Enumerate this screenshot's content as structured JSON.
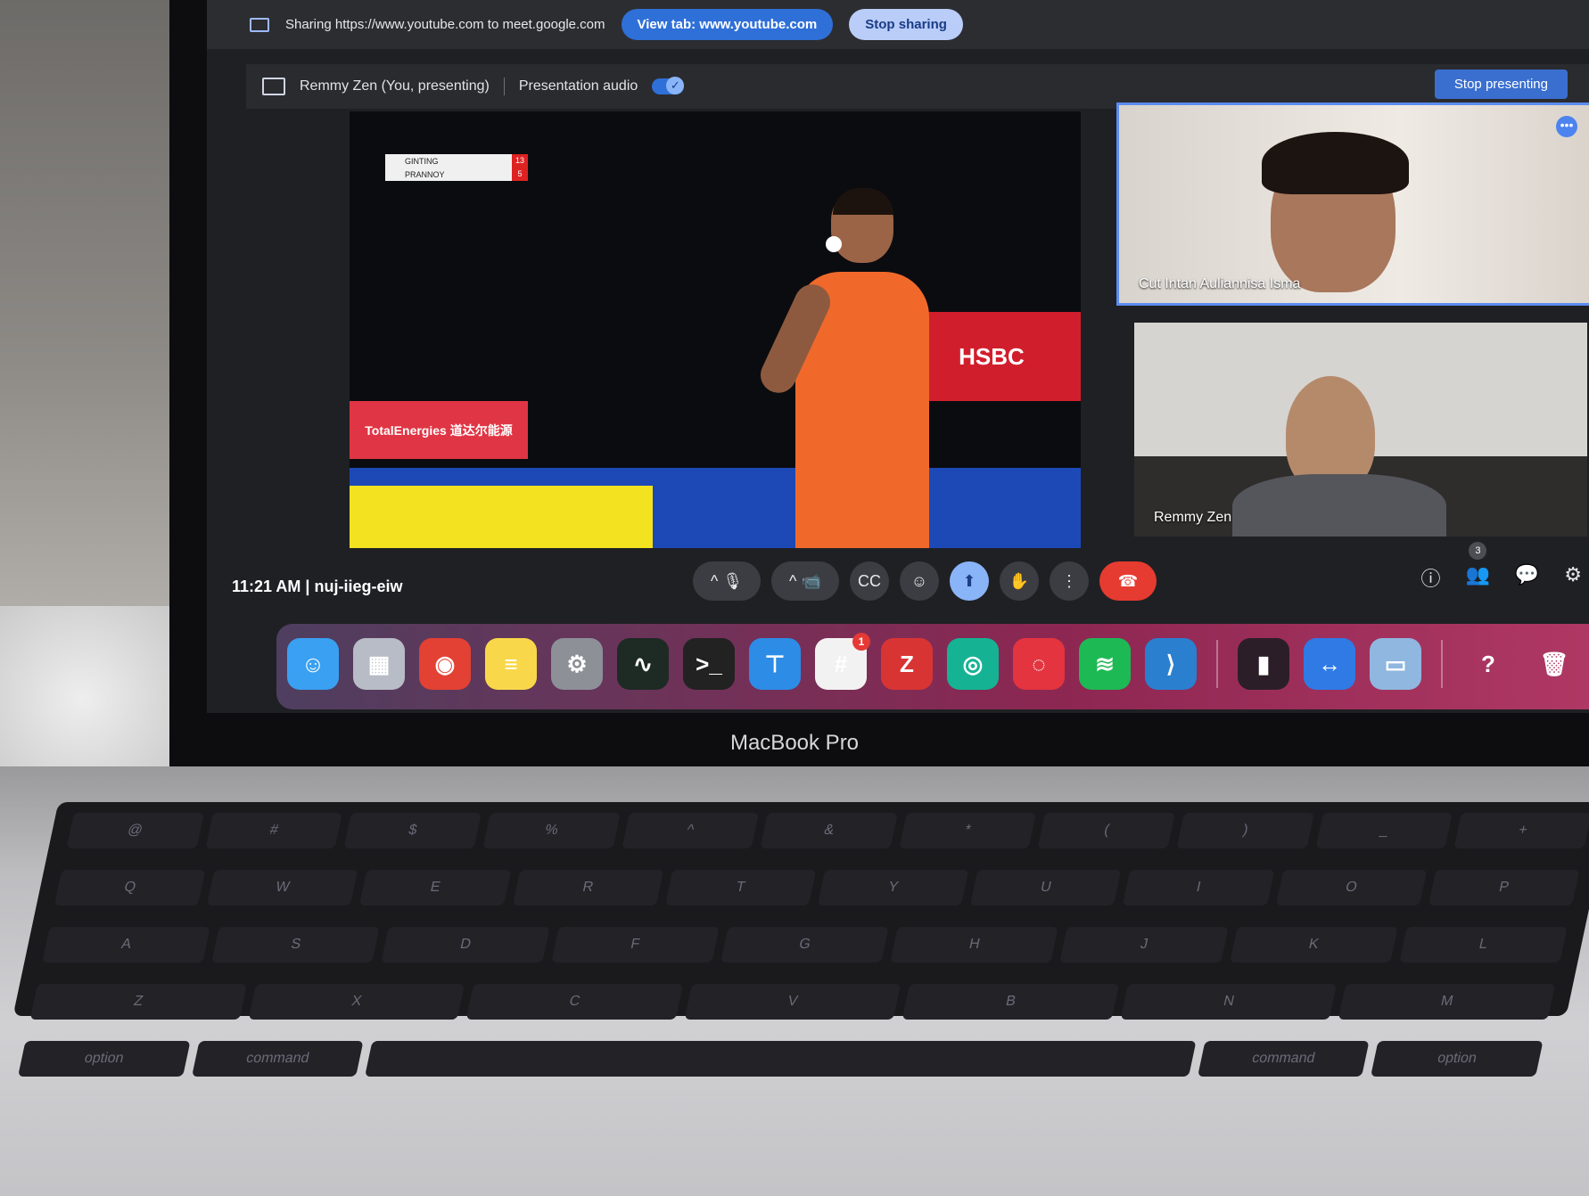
{
  "share_bar": {
    "sharing_text": "Sharing https://www.youtube.com to meet.google.com",
    "view_tab_label": "View tab: www.youtube.com",
    "stop_sharing_label": "Stop sharing"
  },
  "present_bar": {
    "presenter_text": "Remmy Zen (You, presenting)",
    "audio_label": "Presentation audio",
    "stop_presenting_label": "Stop presenting"
  },
  "video": {
    "scoreboard": {
      "player1": "GINTING",
      "player2": "PRANNOY",
      "score1": "13",
      "score2": "5"
    },
    "ad_left": "TotalEnergies 道达尔能源",
    "ad_right": "HSBC"
  },
  "participants": [
    {
      "name": "Cut Intan Auliannisa Isma"
    },
    {
      "name": "Remmy Zen"
    }
  ],
  "meeting": {
    "time": "11:21 AM",
    "separator": "|",
    "code": "nuj-iieg-eiw"
  },
  "controls": {
    "mic_icon": "🎙",
    "camera_icon": "📹",
    "captions_icon": "CC",
    "emoji_icon": "☺",
    "present_icon": "⬆",
    "raise_hand_icon": "✋",
    "more_icon": "⋮",
    "hangup_icon": "☎",
    "chevron": "^"
  },
  "right_controls": {
    "info_icon": "ⓘ",
    "people_icon": "👥",
    "people_count": "3",
    "chat_icon": "💬",
    "activities_icon": "⚙"
  },
  "dock": {
    "apps": [
      {
        "name": "finder",
        "glyph": "☺",
        "color": "#3aa0f2"
      },
      {
        "name": "launchpad",
        "glyph": "▦",
        "color": "#b8bcc6"
      },
      {
        "name": "chrome",
        "glyph": "◉",
        "color": "#e24134"
      },
      {
        "name": "notes",
        "glyph": "≡",
        "color": "#f8d84a"
      },
      {
        "name": "system-preferences",
        "glyph": "⚙",
        "color": "#8d9097"
      },
      {
        "name": "activity-monitor",
        "glyph": "∿",
        "color": "#1e2a24"
      },
      {
        "name": "terminal",
        "glyph": ">_",
        "color": "#222"
      },
      {
        "name": "keynote",
        "glyph": "⊤",
        "color": "#2d8ce6"
      },
      {
        "name": "slack",
        "glyph": "#",
        "color": "#f2f2f2",
        "badge": "1"
      },
      {
        "name": "zotero",
        "glyph": "Z",
        "color": "#d93434"
      },
      {
        "name": "element",
        "glyph": "◎",
        "color": "#15b394"
      },
      {
        "name": "rocketchat",
        "glyph": "◌",
        "color": "#e4343f"
      },
      {
        "name": "spotify",
        "glyph": "≋",
        "color": "#1db954"
      },
      {
        "name": "vscode",
        "glyph": "⟩",
        "color": "#2a7fcf"
      }
    ],
    "apps_right": [
      {
        "name": "voice-memos",
        "glyph": "▮",
        "color": "#2c1e28"
      },
      {
        "name": "teamviewer",
        "glyph": "↔",
        "color": "#2f7ae5"
      },
      {
        "name": "preview",
        "glyph": "▭",
        "color": "#8fb7df"
      }
    ],
    "extras": [
      {
        "name": "help",
        "glyph": "?",
        "color": "transparent"
      },
      {
        "name": "trash",
        "glyph": "🗑",
        "color": "transparent"
      }
    ]
  },
  "laptop_label": "MacBook Pro",
  "keyboard": {
    "row1": [
      "@",
      "#",
      "$",
      "%",
      "^",
      "&",
      "*",
      "(",
      ")",
      "_",
      "+"
    ],
    "row2": [
      "Q",
      "W",
      "E",
      "R",
      "T",
      "Y",
      "U",
      "I",
      "O",
      "P"
    ],
    "row3": [
      "A",
      "S",
      "D",
      "F",
      "G",
      "H",
      "J",
      "K",
      "L"
    ],
    "row4": [
      "Z",
      "X",
      "C",
      "V",
      "B",
      "N",
      "M"
    ],
    "row5": [
      "option",
      "command",
      "",
      "command",
      "option"
    ]
  }
}
